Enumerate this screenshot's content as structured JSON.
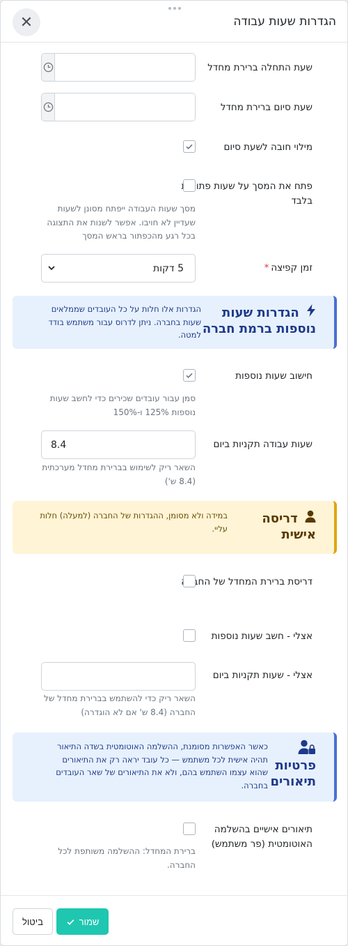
{
  "dialog": {
    "title": "הגדרות שעות עבודה",
    "close_icon": "close-icon"
  },
  "fields": {
    "default_start": {
      "label": "שעת התחלה ברירת מחדל",
      "value": ""
    },
    "default_end": {
      "label": "שעת סיום ברירת מחדל",
      "value": ""
    },
    "require_end": {
      "label": "מילוי חובה לשעת סיום",
      "checked": true
    },
    "open_only": {
      "label": "פתח את המסך על שעות פתוחות בלבד",
      "checked": false,
      "hint": "מסך שעות העבודה ייפתח מסונן לשעות שעדיין לא חויבו. אפשר לשנות את התצוגה בכל רגע מהכפתור בראש המסך"
    },
    "jump_time": {
      "label": "זמן קפיצה",
      "required_mark": "*",
      "value": "5 דקות"
    }
  },
  "company_card": {
    "title": "הגדרות שעות נוספות ברמת חברה",
    "text": "הגדרות אלו חלות על כל העובדים שממלאים שעות בחברה. ניתן לדרוס עבור משתמש בודד למטה.",
    "icon": "lightning-icon"
  },
  "company": {
    "overtime": {
      "label": "חישוב שעות נוספות",
      "checked": true,
      "hint": "סמן עבור עובדים שכירים כדי לחשב שעות נוספות 125% ו-150%"
    },
    "standard_hours": {
      "label": "שעות עבודה תקניות ביום",
      "value": "8.4",
      "hint": "השאר ריק לשימוש בברירת מחדל מערכתית (8.4 ש')"
    }
  },
  "personal_card": {
    "title": "דריסה אישית",
    "text": "במידה ולא מסומן, ההגדרות של החברה (למעלה) חלות עליי.",
    "icon": "user-icon"
  },
  "personal": {
    "override": {
      "label": "דריסת ברירת המחדל של החברה",
      "checked": false
    },
    "my_overtime": {
      "label": "אצלי - חשב שעות נוספות",
      "checked": false
    },
    "my_hours": {
      "label": "אצלי - שעות תקניות ביום",
      "value": "",
      "hint": "השאר ריק כדי להשתמש בברירת מחדל של החברה (8.4 ש' אם לא הוגדרה)"
    }
  },
  "privacy_card": {
    "title": "פרטיות תיאורים",
    "text": "כאשר האפשרות מסומנת, ההשלמה האוטומטית בשדה התיאור תהיה אישית לכל משתמש — כל עובד יראה רק את התיאורים שהוא עצמו השתמש בהם, ולא את התיאורים של שאר העובדים בחברה.",
    "icon": "user-lock-icon"
  },
  "privacy": {
    "personal_desc": {
      "label": "תיאורים אישיים בהשלמה האוטומטית (פר משתמש)",
      "checked": false,
      "hint": "ברירת המחדל: ההשלמה משותפת לכל החברה."
    }
  },
  "footer": {
    "save": "שמור",
    "cancel": "ביטול"
  },
  "colors": {
    "accent": "#1fc7b0",
    "info_bg": "#e7f1fd",
    "info_border": "#4a6fd1",
    "warning_bg": "#fff4d6",
    "warning_border": "#e0a514",
    "required": "#dc3545"
  }
}
